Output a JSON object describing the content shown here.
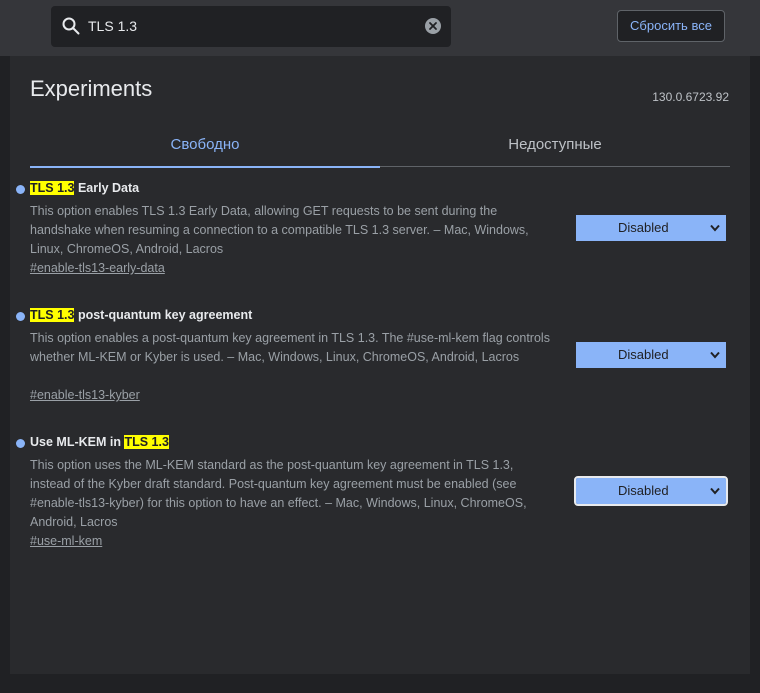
{
  "search": {
    "value": "TLS 1.3",
    "placeholder": ""
  },
  "toolbar": {
    "reset_label": "Сбросить все"
  },
  "page": {
    "title": "Experiments",
    "version": "130.0.6723.92"
  },
  "tabs": [
    {
      "label": "Свободно",
      "active": true
    },
    {
      "label": "Недоступные",
      "active": false
    }
  ],
  "experiments": [
    {
      "title_highlight": "TLS 1.3",
      "title_rest": " Early Data",
      "description": "This option enables TLS 1.3 Early Data, allowing GET requests to be sent during the handshake when resuming a connection to a compatible TLS 1.3 server. – Mac, Windows, Linux, ChromeOS, Android, Lacros",
      "link": "#enable-tls13-early-data",
      "state": "Disabled"
    },
    {
      "title_highlight": "TLS 1.3",
      "title_rest": " post-quantum key agreement",
      "description": "This option enables a post-quantum key agreement in TLS 1.3. The #use-ml-kem flag controls whether ML-KEM or Kyber is used. – Mac, Windows, Linux, ChromeOS, Android, Lacros",
      "link": "#enable-tls13-kyber",
      "state": "Disabled"
    },
    {
      "title_prefix": "Use ML-KEM in ",
      "title_highlight": "TLS 1.3",
      "description": "This option uses the ML-KEM standard as the post-quantum key agreement in TLS 1.3, instead of the Kyber draft standard. Post-quantum key agreement must be enabled (see #enable-tls13-kyber) for this option to have an effect. – Mac, Windows, Linux, ChromeOS, Android, Lacros",
      "link": "#use-ml-kem",
      "state": "Disabled"
    }
  ],
  "colors": {
    "accent": "#8ab4f8",
    "highlight": "#ffff00",
    "background": "#202124",
    "panel": "#292a2d"
  },
  "icons": [
    "search-icon",
    "clear-icon",
    "chevron-down-icon"
  ]
}
